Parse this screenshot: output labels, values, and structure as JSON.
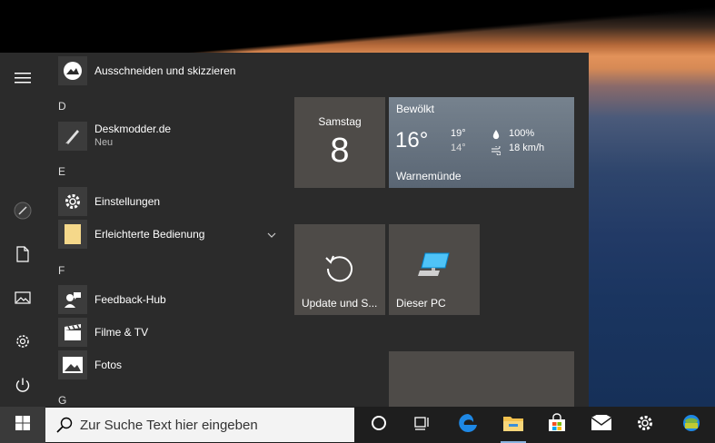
{
  "applist": {
    "items": [
      {
        "label": "Ausschneiden und skizzieren"
      },
      {
        "header": "D"
      },
      {
        "label": "Deskmodder.de",
        "sub": "Neu"
      },
      {
        "header": "E"
      },
      {
        "label": "Einstellungen"
      },
      {
        "label": "Erleichterte Bedienung"
      },
      {
        "header": "F"
      },
      {
        "label": "Feedback-Hub"
      },
      {
        "label": "Filme & TV"
      },
      {
        "label": "Fotos"
      },
      {
        "header": "G"
      }
    ]
  },
  "tiles": {
    "calendar": {
      "day": "Samstag",
      "date": "8"
    },
    "weather": {
      "condition": "Bewölkt",
      "temp": "16°",
      "high": "19°",
      "low": "14°",
      "humidity": "100%",
      "wind": "18 km/h",
      "location": "Warnemünde"
    },
    "update": {
      "label": "Update und S..."
    },
    "pc": {
      "label": "Dieser PC"
    }
  },
  "taskbar": {
    "search_placeholder": "Zur Suche Text hier eingeben"
  },
  "colors": {
    "tile": "#4e4b48",
    "weather_tile": "#6b7a88",
    "menu_bg": "#2b2b2b",
    "taskbar_bg": "#1e1e1e",
    "edge_blue": "#1e88e5"
  }
}
